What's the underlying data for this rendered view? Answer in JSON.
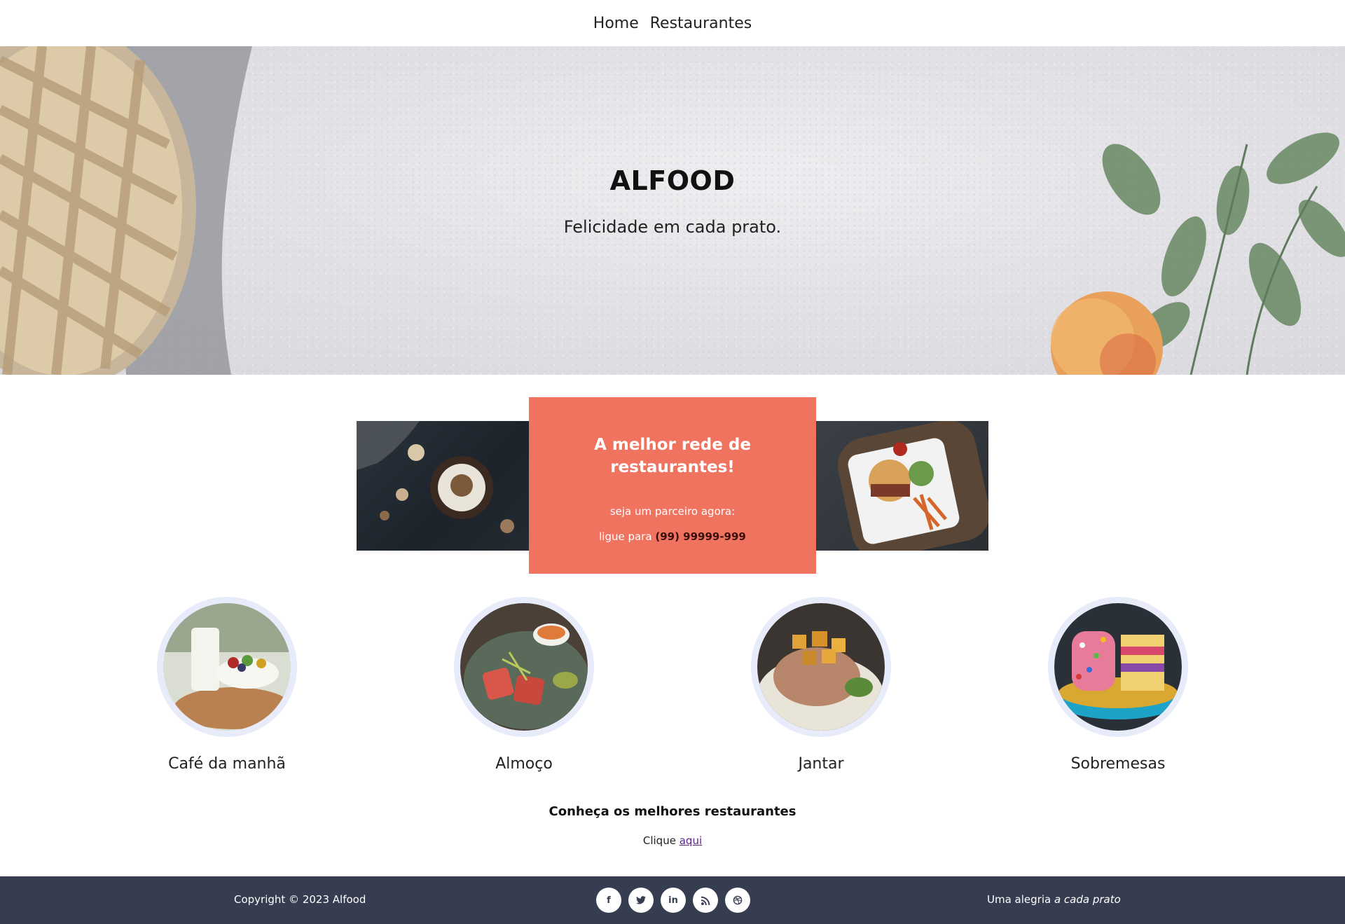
{
  "nav": {
    "home": "Home",
    "restaurants": "Restaurantes"
  },
  "hero": {
    "title": "ALFOOD",
    "subtitle": "Felicidade em cada prato."
  },
  "promo": {
    "title": "A melhor rede de restaurantes!",
    "line1": "seja um parceiro agora:",
    "line2_prefix": "ligue para",
    "phone": "(99) 99999-999"
  },
  "categories": [
    {
      "label": "Café da manhã"
    },
    {
      "label": "Almoço"
    },
    {
      "label": "Jantar"
    },
    {
      "label": "Sobremesas"
    }
  ],
  "cta": {
    "heading": "Conheça os melhores restaurantes",
    "text": "Clique",
    "link": "aqui"
  },
  "footer": {
    "copyright": "Copyright © 2023 Alfood",
    "social": [
      "facebook-icon",
      "twitter-icon",
      "linkedin-icon",
      "rss-icon",
      "dribbble-icon"
    ],
    "tagline_prefix": "Uma alegria",
    "tagline_em": "a cada prato"
  },
  "colors": {
    "promo": "#f07360",
    "footer": "#363d50",
    "circle": "#e8ecfa"
  }
}
